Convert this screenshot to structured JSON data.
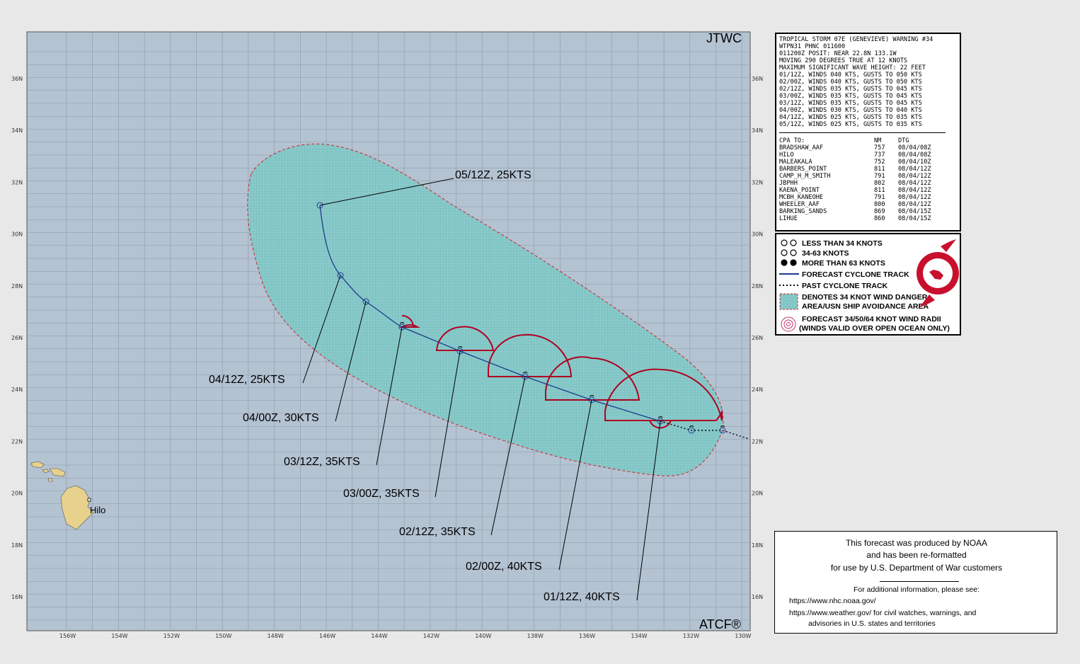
{
  "map": {
    "header_right": "JTWC",
    "footer_right": "ATCF®",
    "city": "Hilo",
    "lat_labels": [
      "36N",
      "34N",
      "32N",
      "30N",
      "28N",
      "26N",
      "24N",
      "22N",
      "20N",
      "18N",
      "16N"
    ],
    "lon_labels": [
      "156W",
      "154W",
      "152W",
      "150W",
      "148W",
      "146W",
      "144W",
      "142W",
      "140W",
      "138W",
      "136W",
      "134W",
      "132W",
      "130W"
    ],
    "forecast_labels": [
      "05/12Z, 25KTS",
      "04/12Z, 25KTS",
      "04/00Z, 30KTS",
      "03/12Z, 35KTS",
      "03/00Z, 35KTS",
      "02/12Z, 35KTS",
      "02/00Z, 40KTS",
      "01/12Z, 40KTS"
    ],
    "colors": {
      "ocean": "#b4c3d2",
      "danger_area": "#7fc4c4",
      "radii": "#b00020",
      "track": "#1e3c8c",
      "land": "#e6d28c"
    }
  },
  "warning": {
    "title": "TROPICAL STORM 07E (GENEVIEVE) WARNING #34",
    "header_lines": [
      "WTPN31 PHNC 011600",
      "011200Z POSIT: NEAR 22.8N 133.1W",
      "MOVING 290 DEGREES TRUE AT 12 KNOTS",
      "MAXIMUM SIGNIFICANT WAVE HEIGHT: 22 FEET",
      "01/12Z, WINDS 040 KTS, GUSTS TO 050 KTS",
      "02/00Z, WINDS 040 KTS, GUSTS TO 050 KTS",
      "02/12Z, WINDS 035 KTS, GUSTS TO 045 KTS",
      "03/00Z, WINDS 035 KTS, GUSTS TO 045 KTS",
      "03/12Z, WINDS 035 KTS, GUSTS TO 045 KTS",
      "04/00Z, WINDS 030 KTS, GUSTS TO 040 KTS",
      "04/12Z, WINDS 025 KTS, GUSTS TO 035 KTS",
      "05/12Z, WINDS 025 KTS, GUSTS TO 035 KTS"
    ],
    "cpa_header": [
      "CPA TO:",
      "NM",
      "DTG"
    ],
    "cpa_rows": [
      [
        "BRADSHAW_AAF",
        "757",
        "08/04/08Z"
      ],
      [
        "HILO",
        "737",
        "08/04/08Z"
      ],
      [
        "MALEAKALA",
        "752",
        "08/04/10Z"
      ],
      [
        "BARBERS_POINT",
        "811",
        "08/04/12Z"
      ],
      [
        "CAMP_H_M_SMITH",
        "791",
        "08/04/12Z"
      ],
      [
        "JBPHH",
        "802",
        "08/04/12Z"
      ],
      [
        "KAENA_POINT",
        "811",
        "08/04/12Z"
      ],
      [
        "MCBH_KANEOHE",
        "791",
        "08/04/12Z"
      ],
      [
        "WHEELER_AAF",
        "800",
        "08/04/12Z"
      ],
      [
        "BARKING_SANDS",
        "869",
        "08/04/15Z"
      ],
      [
        "LIHUE",
        "860",
        "08/04/15Z"
      ]
    ]
  },
  "legend": {
    "items": [
      "LESS THAN 34 KNOTS",
      "34-63 KNOTS",
      "MORE THAN 63 KNOTS",
      "FORECAST CYCLONE TRACK",
      "PAST CYCLONE TRACK",
      "DENOTES 34 KNOT WIND DANGER",
      "AREA/USN SHIP AVOIDANCE AREA",
      "FORECAST 34/50/64 KNOT WIND RADII",
      "(WINDS VALID OVER OPEN OCEAN ONLY)"
    ]
  },
  "note": {
    "line1": "This forecast was produced by NOAA",
    "line2": "and has been re-formatted",
    "line3": "for use by U.S. Department of War customers",
    "line4": "For additional information, please see:",
    "line5": "https://www.nhc.noaa.gov/",
    "line6": "https://www.weather.gov/ for civil watches, warnings, and",
    "line7": "advisories in U.S. states and territories"
  }
}
